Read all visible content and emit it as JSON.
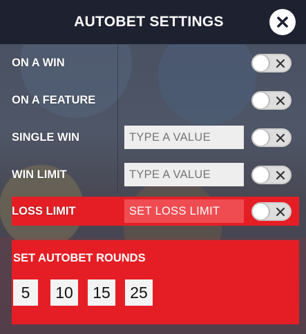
{
  "header": {
    "title": "AUTOBET SETTINGS",
    "close_icon": "close-icon"
  },
  "rows": [
    {
      "label": "ON A WIN",
      "has_input": false,
      "toggle": "off"
    },
    {
      "label": "ON A FEATURE",
      "has_input": false,
      "toggle": "off"
    },
    {
      "label": "SINGLE WIN",
      "has_input": true,
      "placeholder": "TYPE A VALUE",
      "toggle": "off"
    },
    {
      "label": "WIN LIMIT",
      "has_input": true,
      "placeholder": "TYPE A VALUE",
      "toggle": "off"
    },
    {
      "label": "LOSS LIMIT",
      "has_input": true,
      "placeholder": "SET LOSS LIMIT",
      "toggle": "off",
      "highlighted": true
    }
  ],
  "rounds": {
    "title": "SET AUTOBET ROUNDS",
    "options": [
      "5",
      "10",
      "15",
      "25"
    ]
  },
  "colors": {
    "header_bg": "#1d2130",
    "accent_red": "#e51e25",
    "toggle_bg": "#dedede"
  }
}
